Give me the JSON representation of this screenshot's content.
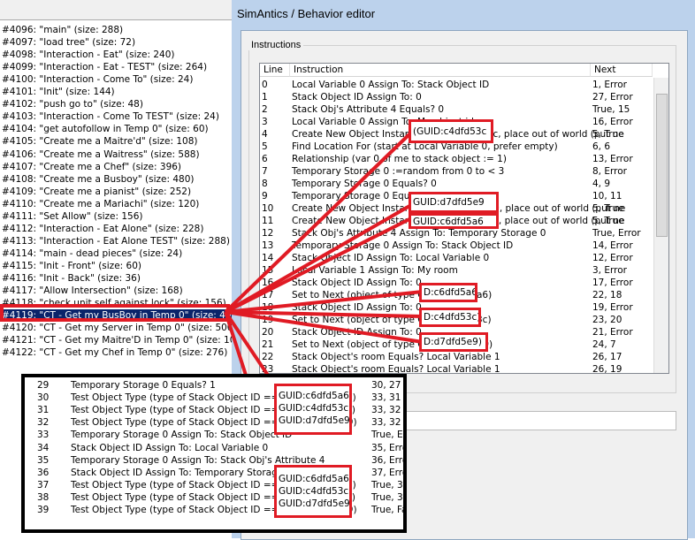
{
  "left_list": {
    "items": [
      "#4096: \"main\" (size: 288)",
      "#4097: \"load tree\" (size: 72)",
      "#4098: \"Interaction - Eat\" (size: 240)",
      "#4099: \"Interaction - Eat - TEST\" (size: 264)",
      "#4100: \"Interaction - Come To\" (size: 24)",
      "#4101: \"Init\" (size: 144)",
      "#4102: \"push go to\" (size: 48)",
      "#4103: \"Interaction - Come To TEST\" (size: 24)",
      "#4104: \"get autofollow in Temp 0\" (size: 60)",
      "#4105: \"Create me a Maitre'd\" (size: 108)",
      "#4106: \"Create me a Waitress\" (size: 588)",
      "#4107: \"Create me a Chef\" (size: 396)",
      "#4108: \"Create me a Busboy\" (size: 480)",
      "#4109: \"Create me a pianist\" (size: 252)",
      "#4110: \"Create me a Mariachi\" (size: 120)",
      "#4111: \"Set Allow\" (size: 156)",
      "#4112: \"Interaction - Eat Alone\" (size: 228)",
      "#4113: \"Interaction - Eat Alone TEST\" (size: 288)",
      "#4114: \"main - dead pieces\" (size: 24)",
      "#4115: \"Init - Front\" (size: 60)",
      "#4116: \"Init - Back\" (size: 36)",
      "#4117: \"Allow Intersection\" (size: 168)",
      "#4118: \"check unit self against lock\" (size: 156)",
      "#4119: \"CT - Get my BusBoy in Temp 0\" (size: 492)",
      "#4120: \"CT - Get my Server in Temp 0\" (size: 500)",
      "#4121: \"CT - Get my Maitre'D in Temp 0\" (size: 108)",
      "#4122: \"CT - Get my Chef in Temp 0\" (size: 276)"
    ],
    "selected_index": 23
  },
  "window": {
    "title": "SimAntics / Behavior editor",
    "group_label": "Instructions",
    "columns": [
      "Line",
      "Instruction",
      "Next"
    ],
    "rows": [
      [
        "0",
        "Local Variable 0 Assign To: Stack Object ID",
        "1, Error"
      ],
      [
        "1",
        "Stack Object ID Assign To: 0",
        "27, Error"
      ],
      [
        "2",
        "Stack Obj's Attribute 4 Equals? 0",
        "True, 15"
      ],
      [
        "3",
        "Local Variable 0 Assign To: My object id",
        "16, Error"
      ],
      [
        "4",
        "Create New Object Instance (GUID:c4dfd53c, place out of world (put ne",
        "5, True"
      ],
      [
        "5",
        "Find Location For (start at Local Variable 0, prefer empty)",
        "6, 6"
      ],
      [
        "6",
        "Relationship (var 0 of me to stack object := 1)",
        "13, Error"
      ],
      [
        "7",
        "Temporary Storage 0 :=random from 0 to < 3",
        "8, Error"
      ],
      [
        "8",
        "Temporary Storage 0 Equals? 0",
        "4, 9"
      ],
      [
        "9",
        "Temporary Storage 0 Equals? 1",
        "10, 11"
      ],
      [
        "10",
        "Create New Object Instance (GUID:d7dfd5e9, place out of world (put ne",
        "5, True"
      ],
      [
        "11",
        "Create New Object Instance (GUID:c6dfd5a6, place out of world (put ne",
        "5, True"
      ],
      [
        "12",
        "Stack Obj's Attribute 4 Assign To: Temporary Storage 0",
        "True, Error"
      ],
      [
        "13",
        "Temporary Storage 0 Assign To: Stack Object ID",
        "14, Error"
      ],
      [
        "14",
        "Stack Object ID Assign To: Local Variable 0",
        "12, Error"
      ],
      [
        "15",
        "Local Variable 1 Assign To: My room",
        "3, Error"
      ],
      [
        "16",
        "Stack Object ID Assign To: 0",
        "17, Error"
      ],
      [
        "17",
        "Set to Next (object of type GUID:c6dfd5a6)",
        "22, 18"
      ],
      [
        "18",
        "Stack Object ID Assign To: 0",
        "19, Error"
      ],
      [
        "19",
        "Set to Next (object of type GUID:c4dfd53c)",
        "23, 20"
      ],
      [
        "20",
        "Stack Object ID Assign To: 0",
        "21, Error"
      ],
      [
        "21",
        "Set to Next (object of type GUID:d7dfd5e9)",
        "24, 7"
      ],
      [
        "22",
        "Stack Object's room Equals? Local Variable 1",
        "26, 17"
      ],
      [
        "23",
        "Stack Object's room Equals? Local Variable 1",
        "26, 19"
      ]
    ]
  },
  "zoom_rows": [
    [
      "29",
      "Temporary Storage 0 Equals? 1",
      "30, 27"
    ],
    [
      "30",
      "Test Object Type (type of Stack Object ID == GUID:c6dfd5a6)",
      "33, 31"
    ],
    [
      "31",
      "Test Object Type (type of Stack Object ID == GUID:c4dfd53c)",
      "33, 32"
    ],
    [
      "32",
      "Test Object Type (type of Stack Object ID == GUID:d7dfd5e9)",
      "33, 32"
    ],
    [
      "33",
      "Temporary Storage 0 Assign To: Stack Object ID",
      "True, Erro"
    ],
    [
      "34",
      "Stack Object ID Assign To: Local Variable 0",
      "35, Erro"
    ],
    [
      "35",
      "Temporary Storage 0 Assign To: Stack Obj's Attribute 4",
      "36, Erro"
    ],
    [
      "36",
      "Stack Object ID Assign To: Temporary Storage 0",
      "37, Erro"
    ],
    [
      "37",
      "Test Object Type (type of Stack Object ID == GUID:c6dfd5a6)",
      "True, 38"
    ],
    [
      "38",
      "Test Object Type (type of Stack Object ID == GUID:c4dfd53c)",
      "True, 39"
    ],
    [
      "39",
      "Test Object Type (type of Stack Object ID == GUID:d7dfd5e9)",
      "True, Fa"
    ]
  ],
  "highlights": {
    "h1": "(GUID:c4dfd53c",
    "h2": "GUID:d7dfd5e9",
    "h3": "GUID:c6dfd5a6",
    "h4": "D:c6dfd5a6)",
    "h5": "D:c4dfd53c)",
    "h6": "D:d7dfd5e9)",
    "z1": [
      "GUID:c6dfd5a6)",
      "GUID:c4dfd53c)",
      "GUID:d7dfd5e9)"
    ],
    "z2": [
      "GUID:c6dfd5a6)",
      "GUID:c4dfd53c)",
      "GUID:d7dfd5e9)"
    ]
  },
  "colors": {
    "highlight": "#e01b24",
    "selection": "#0a246a"
  }
}
